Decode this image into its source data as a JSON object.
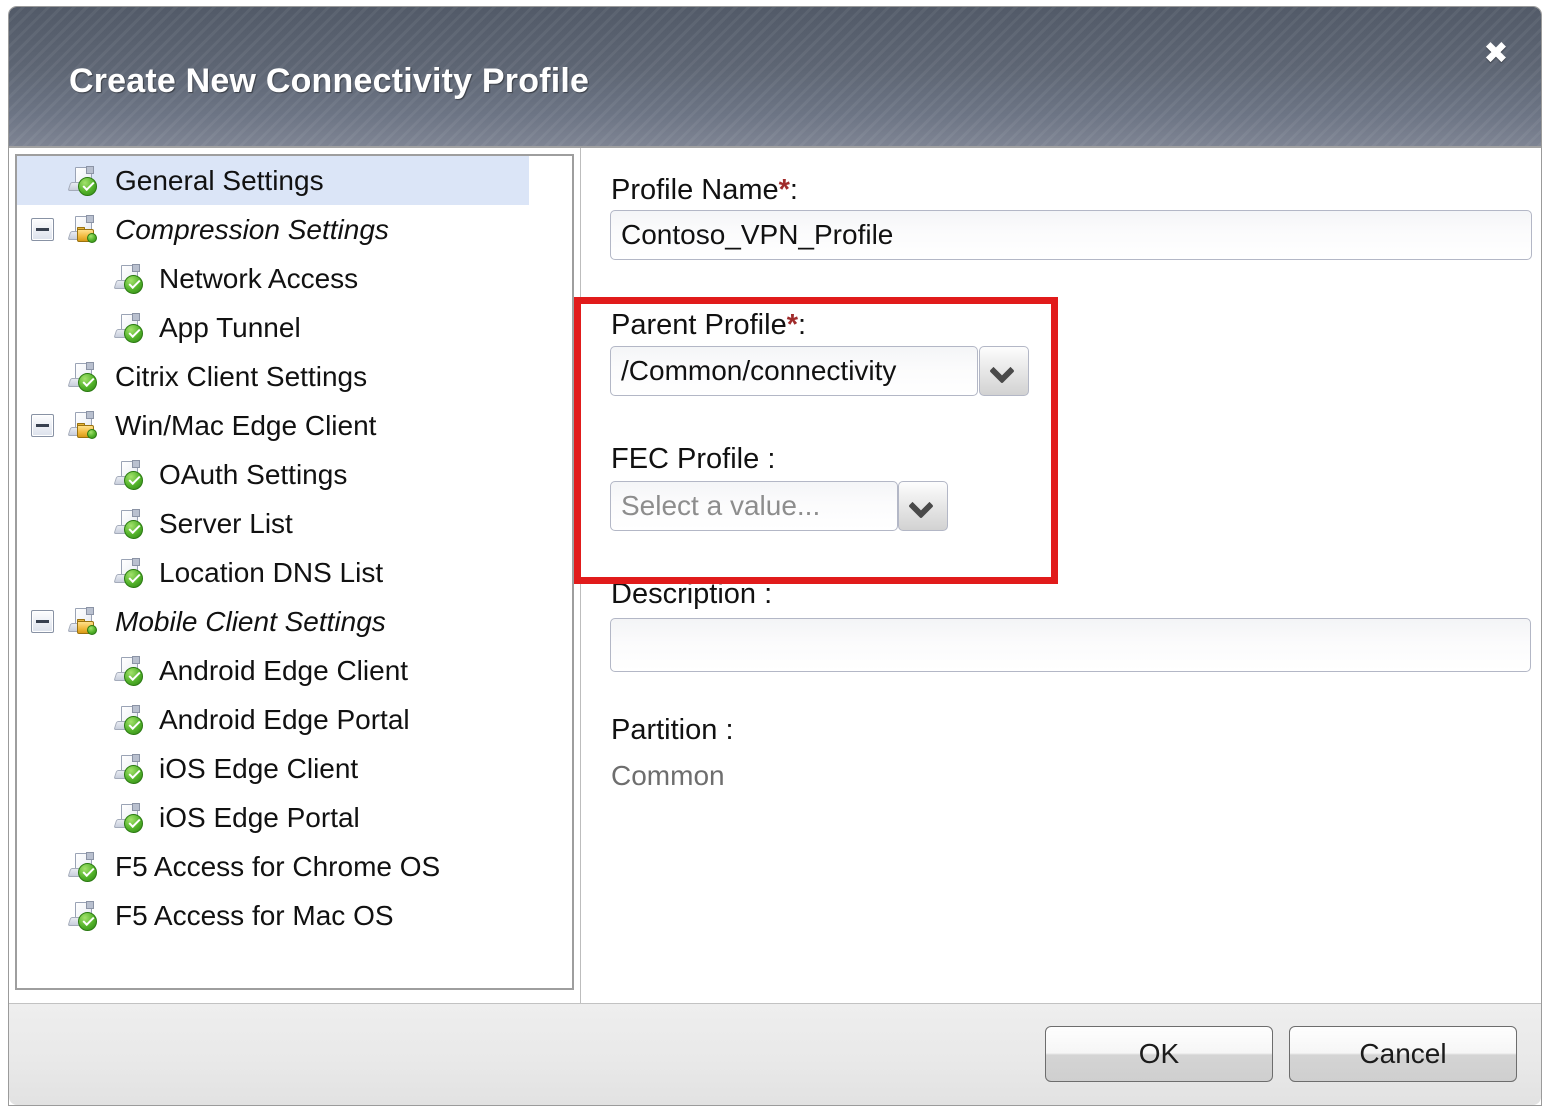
{
  "dialog": {
    "title": "Create New Connectivity Profile",
    "close_icon": "close-icon",
    "close_glyph": "✖"
  },
  "colors": {
    "titlebar": "#5c6472",
    "selected_row": "#dbe5f7",
    "highlight_border": "#e11b1b",
    "required_star": "#a02b2b",
    "badge_green": "#52b22a",
    "badge_folder": "#f2bb41"
  },
  "tree": {
    "items": [
      {
        "label": "General Settings",
        "level": 0,
        "icon": "page-check-icon",
        "italic": false,
        "selected": true,
        "expander": null
      },
      {
        "label": "Compression Settings",
        "level": 0,
        "icon": "page-folder-icon",
        "italic": true,
        "selected": false,
        "expander": "collapse-icon"
      },
      {
        "label": "Network Access",
        "level": 1,
        "icon": "page-check-icon",
        "italic": false,
        "selected": false,
        "expander": null
      },
      {
        "label": "App Tunnel",
        "level": 1,
        "icon": "page-check-icon",
        "italic": false,
        "selected": false,
        "expander": null
      },
      {
        "label": "Citrix Client Settings",
        "level": 0,
        "icon": "page-check-icon",
        "italic": false,
        "selected": false,
        "expander": null
      },
      {
        "label": "Win/Mac Edge Client",
        "level": 0,
        "icon": "page-folder-icon",
        "italic": false,
        "selected": false,
        "expander": "collapse-icon"
      },
      {
        "label": "OAuth Settings",
        "level": 1,
        "icon": "page-check-icon",
        "italic": false,
        "selected": false,
        "expander": null
      },
      {
        "label": "Server List",
        "level": 1,
        "icon": "page-check-icon",
        "italic": false,
        "selected": false,
        "expander": null
      },
      {
        "label": "Location DNS List",
        "level": 1,
        "icon": "page-check-icon",
        "italic": false,
        "selected": false,
        "expander": null
      },
      {
        "label": "Mobile Client Settings",
        "level": 0,
        "icon": "page-folder-icon",
        "italic": true,
        "selected": false,
        "expander": "collapse-icon"
      },
      {
        "label": "Android Edge Client",
        "level": 1,
        "icon": "page-check-icon",
        "italic": false,
        "selected": false,
        "expander": null
      },
      {
        "label": "Android Edge Portal",
        "level": 1,
        "icon": "page-check-icon",
        "italic": false,
        "selected": false,
        "expander": null
      },
      {
        "label": "iOS Edge Client",
        "level": 1,
        "icon": "page-check-icon",
        "italic": false,
        "selected": false,
        "expander": null
      },
      {
        "label": "iOS Edge Portal",
        "level": 1,
        "icon": "page-check-icon",
        "italic": false,
        "selected": false,
        "expander": null
      },
      {
        "label": "F5 Access for Chrome OS",
        "level": 0,
        "icon": "page-check-icon",
        "italic": false,
        "selected": false,
        "expander": null
      },
      {
        "label": "F5 Access for Mac OS",
        "level": 0,
        "icon": "page-check-icon",
        "italic": false,
        "selected": false,
        "expander": null
      }
    ]
  },
  "form": {
    "profile_name": {
      "label": "Profile Name",
      "required_marker": "*",
      "colon": ":",
      "value": "Contoso_VPN_Profile"
    },
    "parent_profile": {
      "label": "Parent Profile",
      "required_marker": "*",
      "colon": ":",
      "value": "/Common/connectivity",
      "dropdown_icon": "chevron-down-icon"
    },
    "fec_profile": {
      "label": "FEC Profile :",
      "value": "Select a value...",
      "dropdown_icon": "chevron-down-icon"
    },
    "description": {
      "label": "Description :",
      "value": ""
    },
    "partition": {
      "label": "Partition :",
      "value": "Common"
    }
  },
  "footer": {
    "ok_label": "OK",
    "cancel_label": "Cancel"
  }
}
